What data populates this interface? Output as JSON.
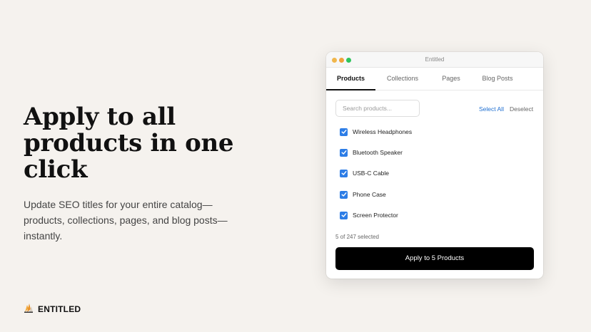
{
  "hero": {
    "title": "Apply to all products in one click",
    "subtitle": "Update SEO titles for your entire catalog—products, collections, pages, and blog posts—instantly."
  },
  "brand": {
    "name": "ENTITLED"
  },
  "window": {
    "title": "Entitled",
    "tabs": [
      {
        "label": "Products",
        "active": true
      },
      {
        "label": "Collections",
        "active": false
      },
      {
        "label": "Pages",
        "active": false
      },
      {
        "label": "Blog Posts",
        "active": false
      }
    ],
    "search": {
      "placeholder": "Search products..."
    },
    "select_all_label": "Select All",
    "deselect_label": "Deselect",
    "items": [
      {
        "label": "Wireless Headphones",
        "checked": true
      },
      {
        "label": "Bluetooth Speaker",
        "checked": true
      },
      {
        "label": "USB-C Cable",
        "checked": true
      },
      {
        "label": "Phone Case",
        "checked": true
      },
      {
        "label": "Screen Protector",
        "checked": true
      }
    ],
    "selection_count": "5 of 247 selected",
    "apply_label": "Apply to 5 Products"
  },
  "colors": {
    "background": "#f5f2ee",
    "accent": "#2d7de6",
    "link": "#1f6fd1",
    "button": "#000000"
  }
}
